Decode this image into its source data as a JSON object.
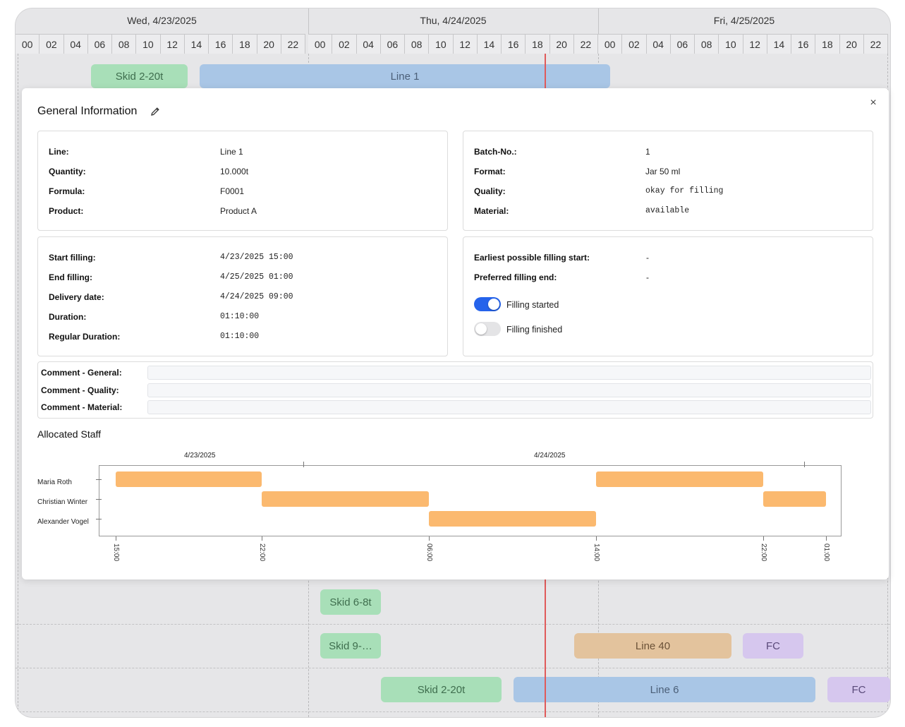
{
  "timeline": {
    "days": [
      "Wed, 4/23/2025",
      "Thu, 4/24/2025",
      "Fri, 4/25/2025"
    ],
    "hours": [
      "00",
      "02",
      "04",
      "06",
      "08",
      "10",
      "12",
      "14",
      "16",
      "18",
      "20",
      "22"
    ],
    "bars_top": [
      {
        "label": "Skid 2-20t",
        "color": "green"
      },
      {
        "label": "Line 1",
        "color": "blue"
      }
    ],
    "bars_bottom": [
      {
        "label": "Skid 6-8t",
        "color": "green"
      },
      {
        "label": "Skid 9-…",
        "color": "green"
      },
      {
        "label": "Line 40",
        "color": "tan"
      },
      {
        "label": "FC",
        "color": "purple"
      },
      {
        "label": "Skid 2-20t",
        "color": "green"
      },
      {
        "label": "Line 6",
        "color": "blue"
      },
      {
        "label": "FC",
        "color": "purple"
      }
    ]
  },
  "modal": {
    "title": "General Information",
    "close_label": "×",
    "info_left": [
      {
        "label": "Line:",
        "value": "Line 1"
      },
      {
        "label": "Quantity:",
        "value": "10.000t"
      },
      {
        "label": "Formula:",
        "value": "F0001"
      },
      {
        "label": "Product:",
        "value": "Product A"
      }
    ],
    "info_right": [
      {
        "label": "Batch-No.:",
        "value": "1"
      },
      {
        "label": "Format:",
        "value": "Jar 50 ml"
      },
      {
        "label": "Quality:",
        "value": "okay for filling"
      },
      {
        "label": "Material:",
        "value": "available"
      }
    ],
    "times": [
      {
        "label": "Start filling:",
        "value": "4/23/2025 15:00"
      },
      {
        "label": "End filling:",
        "value": "4/25/2025 01:00"
      },
      {
        "label": "Delivery date:",
        "value": "4/24/2025 09:00"
      },
      {
        "label": "Duration:",
        "value": "01:10:00"
      },
      {
        "label": "Regular Duration:",
        "value": "01:10:00"
      }
    ],
    "constraints": [
      {
        "label": "Earliest possible filling start:",
        "value": "-"
      },
      {
        "label": "Preferred filling end:",
        "value": "-"
      }
    ],
    "toggles": [
      {
        "label": "Filling started",
        "on": true
      },
      {
        "label": "Filling finished",
        "on": false
      }
    ],
    "comments": [
      {
        "label": "Comment - General:",
        "value": ""
      },
      {
        "label": "Comment - Quality:",
        "value": ""
      },
      {
        "label": "Comment - Material:",
        "value": ""
      }
    ],
    "staff_section_title": "Allocated Staff",
    "accent_color": "#2563eb",
    "gantt_color": "#fbb96f"
  },
  "chart_data": {
    "type": "gantt",
    "date_labels": [
      "4/23/2025",
      "4/24/2025"
    ],
    "tick_labels": [
      "15:00",
      "22:00",
      "06:00",
      "14:00",
      "22:00",
      "01:00"
    ],
    "staff": [
      "Maria Roth",
      "Christian Winter",
      "Alexander Vogel"
    ],
    "assignments": [
      {
        "staff": "Maria Roth",
        "start": "4/23/2025 15:00",
        "end": "4/23/2025 22:00"
      },
      {
        "staff": "Christian Winter",
        "start": "4/23/2025 22:00",
        "end": "4/24/2025 06:00"
      },
      {
        "staff": "Alexander Vogel",
        "start": "4/24/2025 06:00",
        "end": "4/24/2025 14:00"
      },
      {
        "staff": "Maria Roth",
        "start": "4/24/2025 14:00",
        "end": "4/24/2025 22:00"
      },
      {
        "staff": "Christian Winter",
        "start": "4/24/2025 22:00",
        "end": "4/25/2025 01:00"
      }
    ]
  }
}
